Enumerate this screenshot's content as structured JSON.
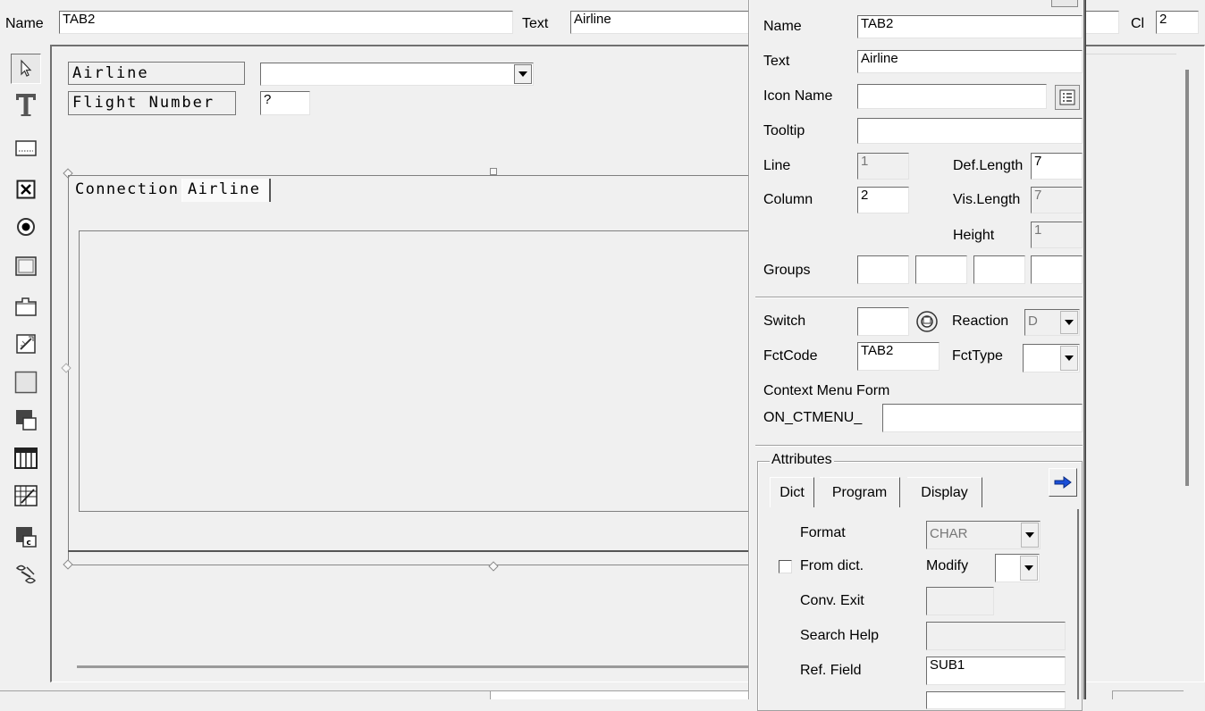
{
  "top_bar": {
    "name_label": "Name",
    "name_value": "TAB2",
    "text_label": "Text",
    "text_value": "Airline",
    "cl_label": "Cl",
    "cl_value": "2"
  },
  "toolbox": {
    "tools": [
      "pointer-icon",
      "text-field-icon",
      "input-field-icon",
      "checkbox-icon",
      "radio-button-icon",
      "pushbutton-icon",
      "tabstrip-icon",
      "tabstrip-wizard-icon",
      "box-icon",
      "subscreen-icon",
      "table-control-icon",
      "table-wizard-icon",
      "custom-control-icon",
      "status-icon-icon"
    ]
  },
  "canvas": {
    "airline_label": "Airline",
    "flight_label": "Flight Number",
    "flight_value": "?",
    "tab1_label": "Connection",
    "tab2_label": "Airline"
  },
  "props": {
    "name_label": "Name",
    "name_value": "TAB2",
    "text_label": "Text",
    "text_value": "Airline",
    "icon_label": "Icon Name",
    "icon_value": "",
    "tooltip_label": "Tooltip",
    "tooltip_value": "",
    "line_label": "Line",
    "line_value": "1",
    "deflen_label": "Def.Length",
    "deflen_value": "7",
    "column_label": "Column",
    "column_value": "2",
    "vislen_label": "Vis.Length",
    "vislen_value": "7",
    "height_label": "Height",
    "height_value": "1",
    "groups_label": "Groups",
    "switch_label": "Switch",
    "switch_value": "",
    "reaction_label": "Reaction",
    "reaction_value": "D",
    "fctcode_label": "FctCode",
    "fctcode_value": "TAB2",
    "fcttype_label": "FctType",
    "fcttype_value": "",
    "ctxmenu_label": "Context Menu Form",
    "onctmenu_label": "ON_CTMENU_",
    "onctmenu_value": "",
    "attributes_label": "Attributes",
    "tabs": [
      "Dict",
      "Program",
      "Display"
    ],
    "format_label": "Format",
    "format_value": "CHAR",
    "fromdict_label": "From dict.",
    "modify_label": "Modify",
    "modify_value": "",
    "convexit_label": "Conv. Exit",
    "convexit_value": "",
    "searchhelp_label": "Search Help",
    "searchhelp_value": "",
    "reffield_label": "Ref. Field",
    "reffield_value": "SUB1"
  }
}
